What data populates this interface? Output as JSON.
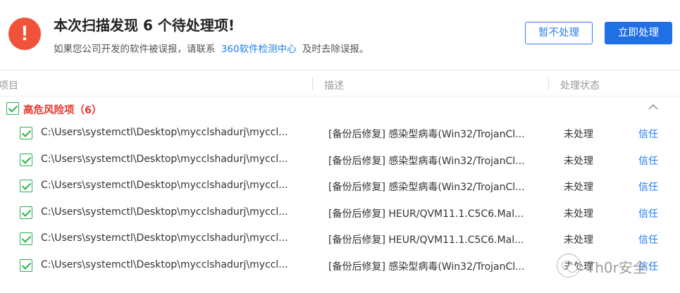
{
  "header": {
    "title": "本次扫描发现 6 个待处理项!",
    "subtitle_before": "如果您公司开发的软件被误报，请联系",
    "subtitle_link": "360软件检测中心",
    "subtitle_after": "及时去除误报。",
    "warning_icon": "exclamation-icon",
    "ignore_button": "暂不处理",
    "fix_button": "立即处理"
  },
  "columns": {
    "item": "项目",
    "desc": "描述",
    "status": "处理状态"
  },
  "group": {
    "label": "高危风险项（6）",
    "collapse_icon": "chevron-up-icon"
  },
  "rows": [
    {
      "path": "C:\\Users\\systemctl\\Desktop\\mycclshadurj\\myccl...",
      "desc": "[备份后修复] 感染型病毒(Win32/TrojanCl...",
      "status": "未处理",
      "action": "信任"
    },
    {
      "path": "C:\\Users\\systemctl\\Desktop\\mycclshadurj\\myccl...",
      "desc": "[备份后修复] 感染型病毒(Win32/TrojanCl...",
      "status": "未处理",
      "action": "信任"
    },
    {
      "path": "C:\\Users\\systemctl\\Desktop\\mycclshadurj\\myccl...",
      "desc": "[备份后修复] 感染型病毒(Win32/TrojanCl...",
      "status": "未处理",
      "action": "信任"
    },
    {
      "path": "C:\\Users\\systemctl\\Desktop\\mycclshadurj\\myccl...",
      "desc": "[备份后修复] HEUR/QVM11.1.C5C6.Mal...",
      "status": "未处理",
      "action": "信任"
    },
    {
      "path": "C:\\Users\\systemctl\\Desktop\\mycclshadurj\\myccl...",
      "desc": "[备份后修复] HEUR/QVM11.1.C5C6.Mal...",
      "status": "未处理",
      "action": "信任"
    },
    {
      "path": "C:\\Users\\systemctl\\Desktop\\mycclshadurj\\myccl...",
      "desc": "[备份后修复] 感染型病毒(Win32/TrojanCl...",
      "status": "未处理",
      "action": "信任"
    }
  ],
  "watermark": "Th0r安全",
  "colors": {
    "danger": "#e5352c",
    "accent": "#1f6fe5",
    "check": "#2cb14a",
    "warning_icon": "#f0533a"
  }
}
